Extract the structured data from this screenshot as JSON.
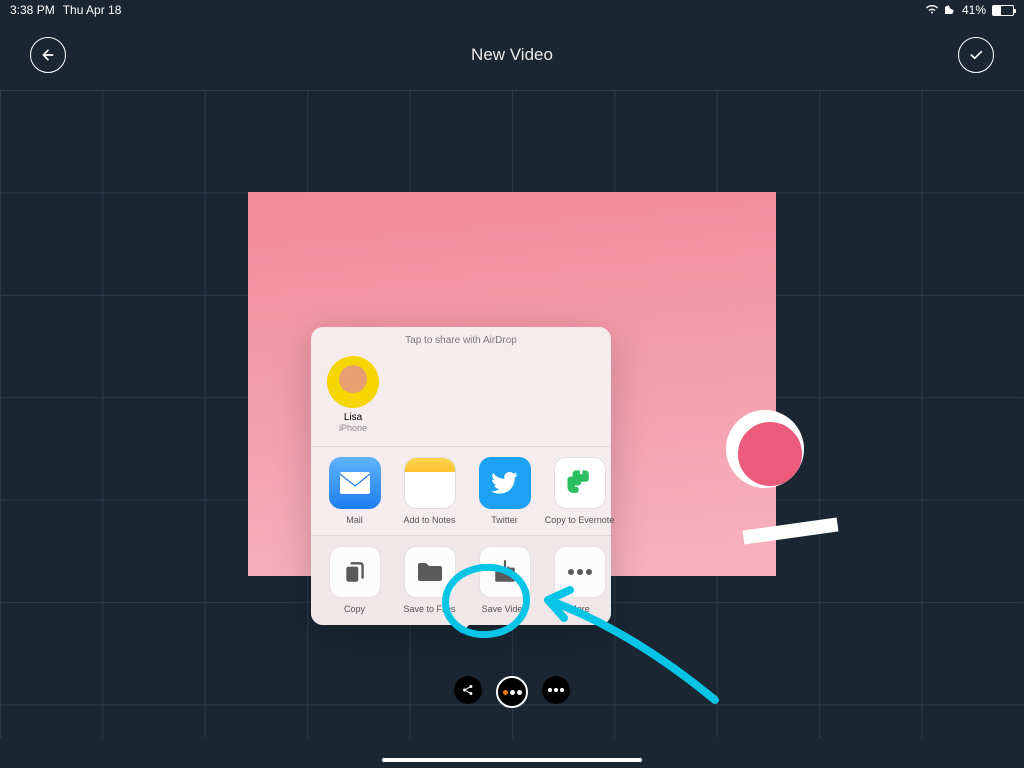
{
  "status_bar": {
    "time": "3:38 PM",
    "date": "Thu Apr 18",
    "battery_pct": "41%"
  },
  "nav": {
    "title": "New Video"
  },
  "share_sheet": {
    "header": "Tap to share with AirDrop",
    "airdrop": {
      "name": "Lisa",
      "device": "iPhone"
    },
    "apps": [
      {
        "label": "Mail"
      },
      {
        "label": "Add to Notes"
      },
      {
        "label": "Twitter"
      },
      {
        "label": "Copy to Evernote"
      }
    ],
    "actions": [
      {
        "label": "Copy"
      },
      {
        "label": "Save to Files"
      },
      {
        "label": "Save Video"
      },
      {
        "label": "More"
      }
    ]
  },
  "annotation": {
    "highlight_target": "Save Video",
    "color": "#06c4e6"
  }
}
